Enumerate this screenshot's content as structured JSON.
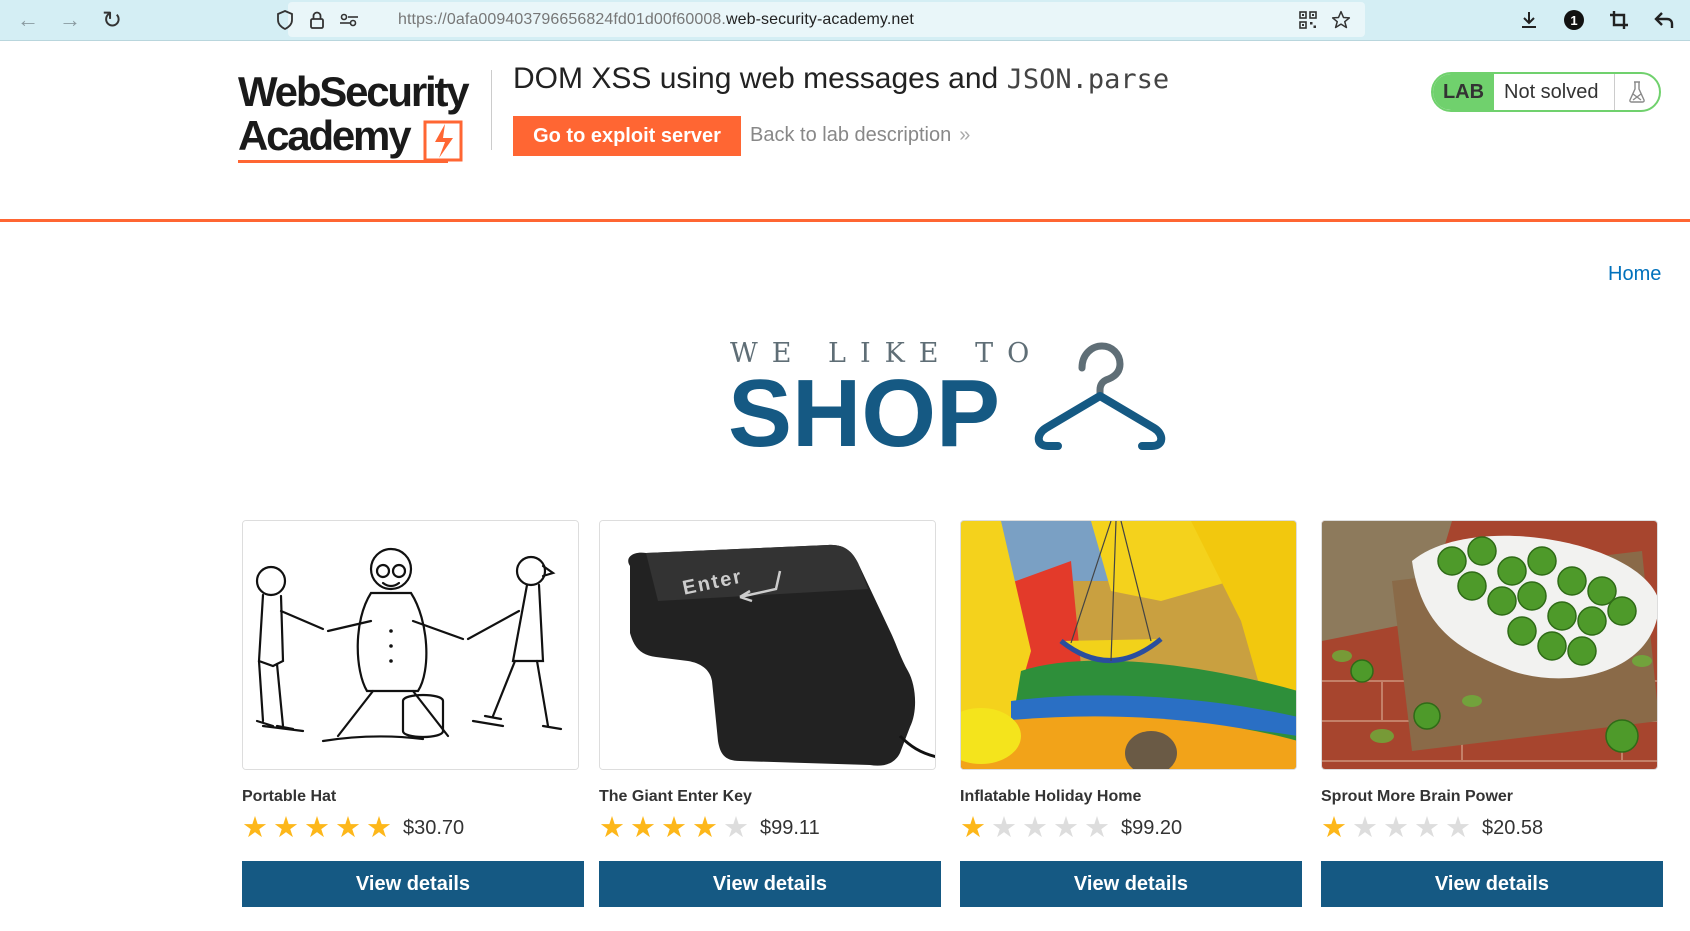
{
  "browser": {
    "url_prefix": "https://0afa009403796656824fd01d00f60008.",
    "url_domain": "web-security-academy.net",
    "icons": [
      "back-arrow-icon",
      "forward-arrow-icon",
      "reload-icon",
      "shield-icon",
      "lock-icon",
      "site-settings-icon",
      "qr-code-icon",
      "bookmark-star-icon",
      "download-icon",
      "extension-badge-icon",
      "crop-icon",
      "undo-icon"
    ],
    "extension_badge": "1"
  },
  "lab_header": {
    "logo_line1": "WebSecurity",
    "logo_line2": "Academy",
    "title_main": "DOM XSS using web messages and ",
    "title_code": "JSON.parse",
    "exploit_button": "Go to exploit server",
    "back_link": "Back to lab description",
    "back_chevron": "»",
    "lab_badge": "LAB",
    "lab_status": "Not solved",
    "accent_color": "#ff6633",
    "status_color": "#70d16d"
  },
  "nav": {
    "home": "Home"
  },
  "hero": {
    "small": "WE LIKE TO",
    "big": "SHOP",
    "color": "#155983"
  },
  "products": [
    {
      "name": "Portable Hat",
      "rating": 5,
      "price": "$30.70",
      "button": "View details",
      "image": "cartoon-hat-illustration"
    },
    {
      "name": "The Giant Enter Key",
      "rating": 4,
      "price": "$99.11",
      "button": "View details",
      "image": "giant-enter-key-photo",
      "key_label": "Enter"
    },
    {
      "name": "Inflatable Holiday Home",
      "rating": 1,
      "price": "$99.20",
      "button": "View details",
      "image": "inflatable-bouncy-castle-photo"
    },
    {
      "name": "Sprout More Brain Power",
      "rating": 1,
      "price": "$20.58",
      "button": "View details",
      "image": "brussels-sprouts-bowl-photo"
    }
  ]
}
